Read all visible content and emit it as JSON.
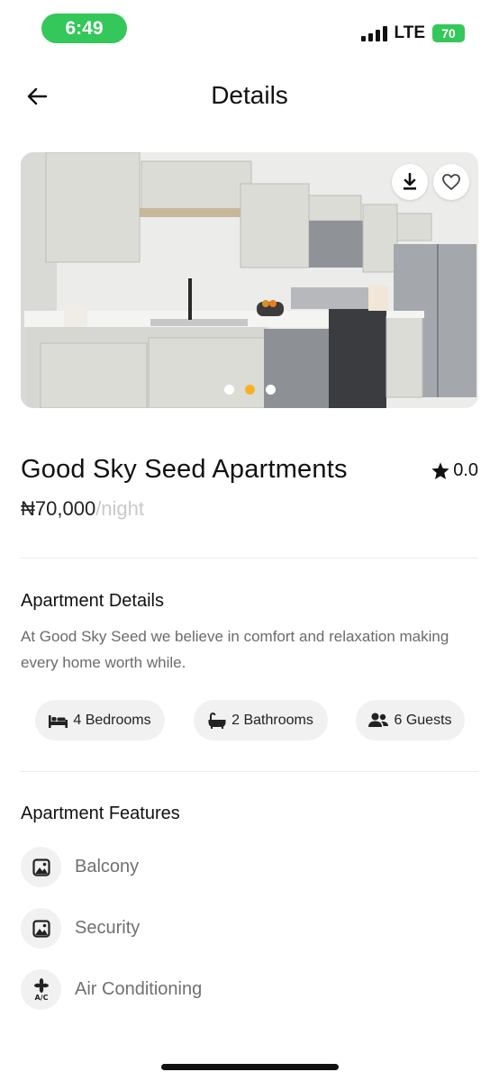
{
  "status_bar": {
    "time": "6:49",
    "network": "LTE",
    "battery": "70"
  },
  "header": {
    "title": "Details"
  },
  "hero": {
    "active_slide": 2,
    "slide_count": 3,
    "active_dot_color": "#f5b324"
  },
  "listing": {
    "name": "Good Sky Seed Apartments",
    "rating": "0.0",
    "price": "₦70,000",
    "price_unit": "/night"
  },
  "details": {
    "title": "Apartment Details",
    "description": "At Good Sky Seed we believe in comfort and relaxation making every home worth while.",
    "chips": [
      {
        "icon": "bed-icon",
        "label": "4 Bedrooms"
      },
      {
        "icon": "bathtub-icon",
        "label": "2 Bathrooms"
      },
      {
        "icon": "guests-icon",
        "label": "6 Guests"
      }
    ]
  },
  "features": {
    "title": "Apartment Features",
    "items": [
      {
        "icon": "image-icon",
        "label": "Balcony"
      },
      {
        "icon": "image-icon",
        "label": "Security"
      },
      {
        "icon": "air-conditioner-icon",
        "label": "Air Conditioning",
        "icon_text": "A/C"
      }
    ]
  },
  "colors": {
    "status_green": "#34c759",
    "chip_bg": "#f1f1f1",
    "muted_text": "#6b6b6b"
  }
}
